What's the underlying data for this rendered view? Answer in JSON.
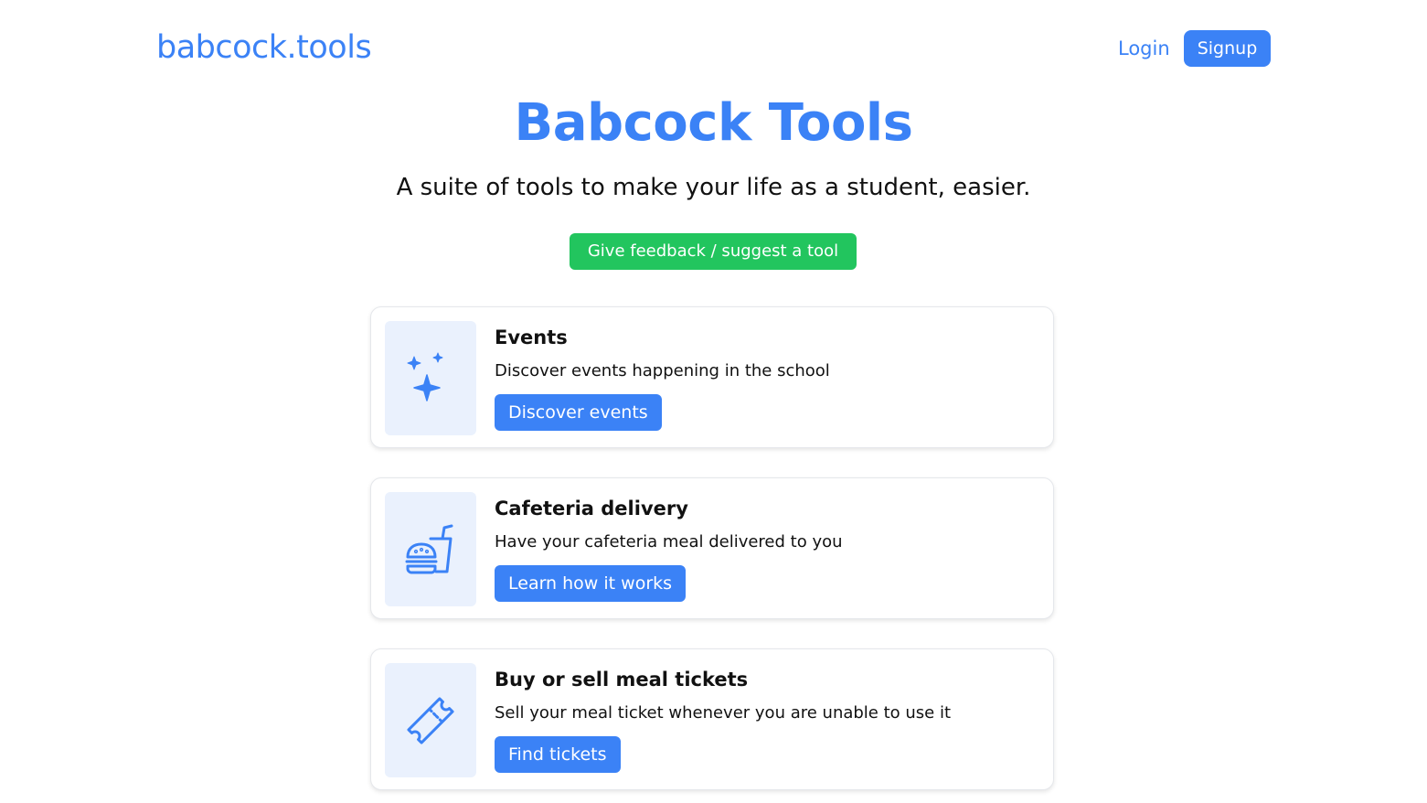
{
  "header": {
    "logo": "babcock.tools",
    "login_label": "Login",
    "signup_label": "Signup"
  },
  "hero": {
    "title": "Babcock Tools",
    "subtitle": "A suite of tools to make your life as a student, easier.",
    "feedback_label": "Give feedback / suggest a tool"
  },
  "tools": [
    {
      "icon": "sparkles-icon",
      "title": "Events",
      "description": "Discover events happening in the school",
      "button_label": "Discover events"
    },
    {
      "icon": "fast-food-icon",
      "title": "Cafeteria delivery",
      "description": "Have your cafeteria meal delivered to you",
      "button_label": "Learn how it works"
    },
    {
      "icon": "ticket-icon",
      "title": "Buy or sell meal tickets",
      "description": "Sell your meal ticket whenever you are unable to use it",
      "button_label": "Find tickets"
    }
  ],
  "colors": {
    "accent": "#3b82f6",
    "success": "#22c55e",
    "icon_background": "#eaf1fd",
    "text": "#111111"
  }
}
